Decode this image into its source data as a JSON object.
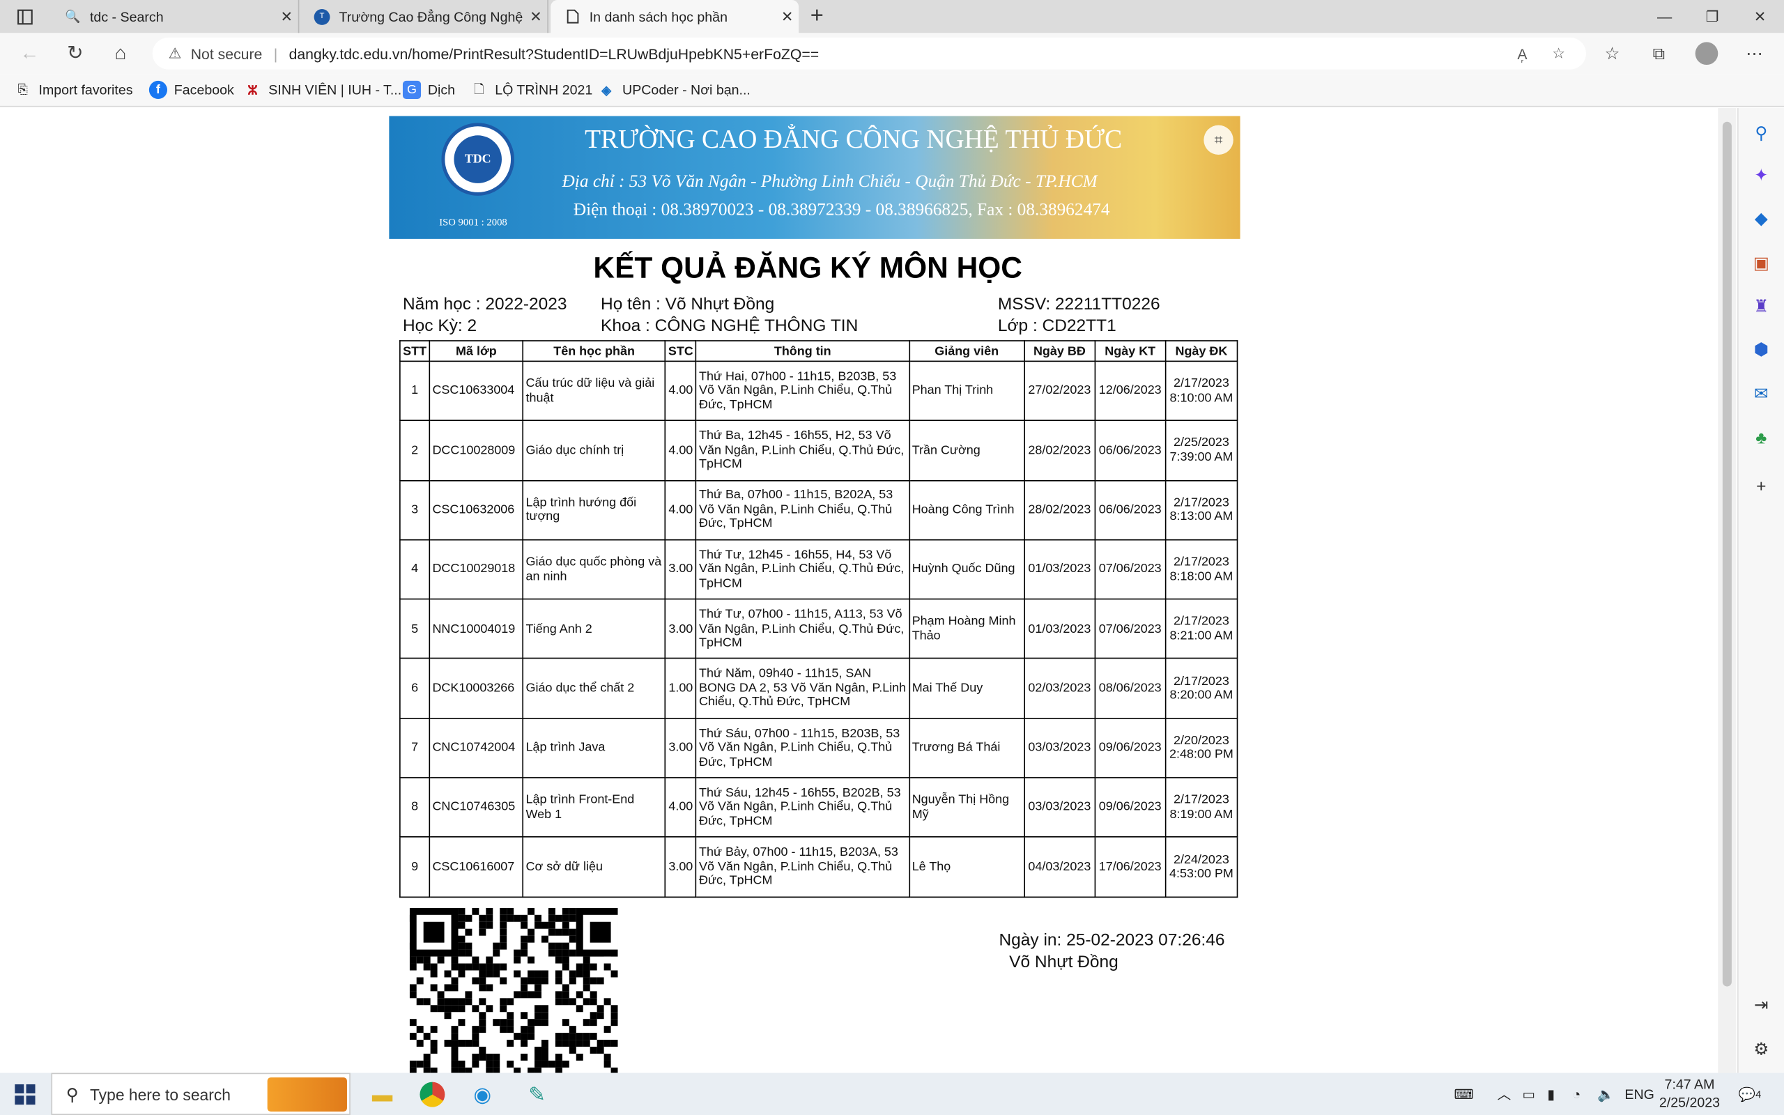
{
  "browser": {
    "tabs": [
      {
        "title": "tdc - Search",
        "icon": "search-icon",
        "active": false
      },
      {
        "title": "Trường Cao Đẳng Công Nghệ Th",
        "icon": "school-icon",
        "active": false
      },
      {
        "title": "In danh sách học phần",
        "icon": "page-icon",
        "active": true
      }
    ],
    "security": "Not secure",
    "url": "dangky.tdc.edu.vn/home/PrintResult?StudentID=LRUwBdjuHpebKN5+erFoZQ==",
    "favorites": [
      {
        "label": "Import favorites",
        "icon": "import-icon"
      },
      {
        "label": "Facebook",
        "icon": "facebook-icon"
      },
      {
        "label": "SINH VIÊN | IUH - T...",
        "icon": "iuh-icon"
      },
      {
        "label": "Dịch",
        "icon": "translate-icon"
      },
      {
        "label": "LỘ TRÌNH 2021",
        "icon": "document-icon"
      },
      {
        "label": "UPCoder - Nơi bạn...",
        "icon": "upcoder-icon"
      }
    ]
  },
  "banner": {
    "title": "TRƯỜNG CAO ĐẲNG CÔNG NGHỆ THỦ ĐỨC",
    "address": "Địa chỉ : 53 Võ Văn Ngân - Phường Linh Chiểu - Quận Thủ Đức - TP.HCM",
    "phone": "Điện thoại : 08.38970023 - 08.38972339 - 08.38966825, Fax : 08.38962474",
    "iso": "ISO 9001 : 2008",
    "logo_text": "TDC"
  },
  "report": {
    "title": "KẾT QUẢ ĐĂNG KÝ MÔN HỌC",
    "year": "Năm học : 2022-2023",
    "semester": "Học Kỳ: 2",
    "name": "Họ tên : Võ Nhựt  Đồng",
    "faculty": "Khoa : CÔNG NGHỆ THÔNG TIN",
    "student_id": "MSSV: 22211TT0226",
    "class": "Lớp  : CD22TT1",
    "columns": [
      "STT",
      "Mã lớp",
      "Tên học phần",
      "STC",
      "Thông tin",
      "Giảng viên",
      "Ngày BĐ",
      "Ngày KT",
      "Ngày ĐK"
    ],
    "rows": [
      [
        "1",
        "CSC10633004",
        "Cấu trúc dữ liệu và giải thuật",
        "4.00",
        "Thứ Hai, 07h00 - 11h15, B203B, 53 Võ Văn Ngân, P.Linh Chiểu, Q.Thủ Đức, TpHCM",
        "Phan Thị  Trinh",
        "27/02/2023",
        "12/06/2023",
        "2/17/2023 8:10:00 AM"
      ],
      [
        "2",
        "DCC10028009",
        "Giáo dục chính trị",
        "4.00",
        "Thứ Ba, 12h45 - 16h55, H2, 53 Võ Văn Ngân, P.Linh Chiểu, Q.Thủ Đức, TpHCM",
        "Trần  Cường",
        "28/02/2023",
        "06/06/2023",
        "2/25/2023 7:39:00 AM"
      ],
      [
        "3",
        "CSC10632006",
        "Lập trình hướng đối tượng",
        "4.00",
        "Thứ Ba, 07h00 - 11h15, B202A, 53 Võ Văn Ngân, P.Linh Chiểu, Q.Thủ Đức, TpHCM",
        "Hoàng Công  Trình",
        "28/02/2023",
        "06/06/2023",
        "2/17/2023 8:13:00 AM"
      ],
      [
        "4",
        "DCC10029018",
        "Giáo dục quốc phòng và an ninh",
        "3.00",
        "Thứ Tư, 12h45 - 16h55, H4, 53 Võ Văn Ngân, P.Linh Chiểu, Q.Thủ Đức, TpHCM",
        "Huỳnh Quốc  Dũng",
        "01/03/2023",
        "07/06/2023",
        "2/17/2023 8:18:00 AM"
      ],
      [
        "5",
        "NNC10004019",
        "Tiếng Anh 2",
        "3.00",
        "Thứ Tư, 07h00 - 11h15, A113, 53 Võ Văn Ngân, P.Linh Chiểu, Q.Thủ Đức, TpHCM",
        "Phạm Hoàng Minh Thảo",
        "01/03/2023",
        "07/06/2023",
        "2/17/2023 8:21:00 AM"
      ],
      [
        "6",
        "DCK10003266",
        "Giáo dục thể chất 2",
        "1.00",
        "Thứ Năm, 09h40 - 11h15, SAN BONG DA 2, 53 Võ Văn Ngân, P.Linh Chiểu, Q.Thủ Đức, TpHCM",
        "Mai Thế  Duy",
        "02/03/2023",
        "08/06/2023",
        "2/17/2023 8:20:00 AM"
      ],
      [
        "7",
        "CNC10742004",
        "Lập trình Java",
        "3.00",
        "Thứ Sáu, 07h00 - 11h15, B203B, 53 Võ Văn Ngân, P.Linh Chiểu, Q.Thủ Đức, TpHCM",
        "Trương Bá  Thái",
        "03/03/2023",
        "09/06/2023",
        "2/20/2023 2:48:00 PM"
      ],
      [
        "8",
        "CNC10746305",
        "Lập trình Front-End Web 1",
        "4.00",
        "Thứ Sáu, 12h45 - 16h55, B202B, 53 Võ Văn Ngân, P.Linh Chiểu, Q.Thủ Đức, TpHCM",
        "Nguyễn Thị Hồng Mỹ",
        "03/03/2023",
        "09/06/2023",
        "2/17/2023 8:19:00 AM"
      ],
      [
        "9",
        "CSC10616007",
        "Cơ sở dữ liệu",
        "3.00",
        "Thứ Bảy, 07h00 - 11h15, B203A, 53 Võ Văn Ngân, P.Linh Chiểu, Q.Thủ Đức, TpHCM",
        "Lê  Thọ",
        "04/03/2023",
        "17/06/2023",
        "2/24/2023 4:53:00 PM"
      ]
    ],
    "print_date": "Ngày in: 25-02-2023 07:26:46",
    "print_name": "Võ Nhựt  Đồng"
  },
  "taskbar": {
    "search_placeholder": "Type here to search",
    "lang": "ENG",
    "time": "7:47 AM",
    "date": "2/25/2023",
    "notifications": "4"
  }
}
